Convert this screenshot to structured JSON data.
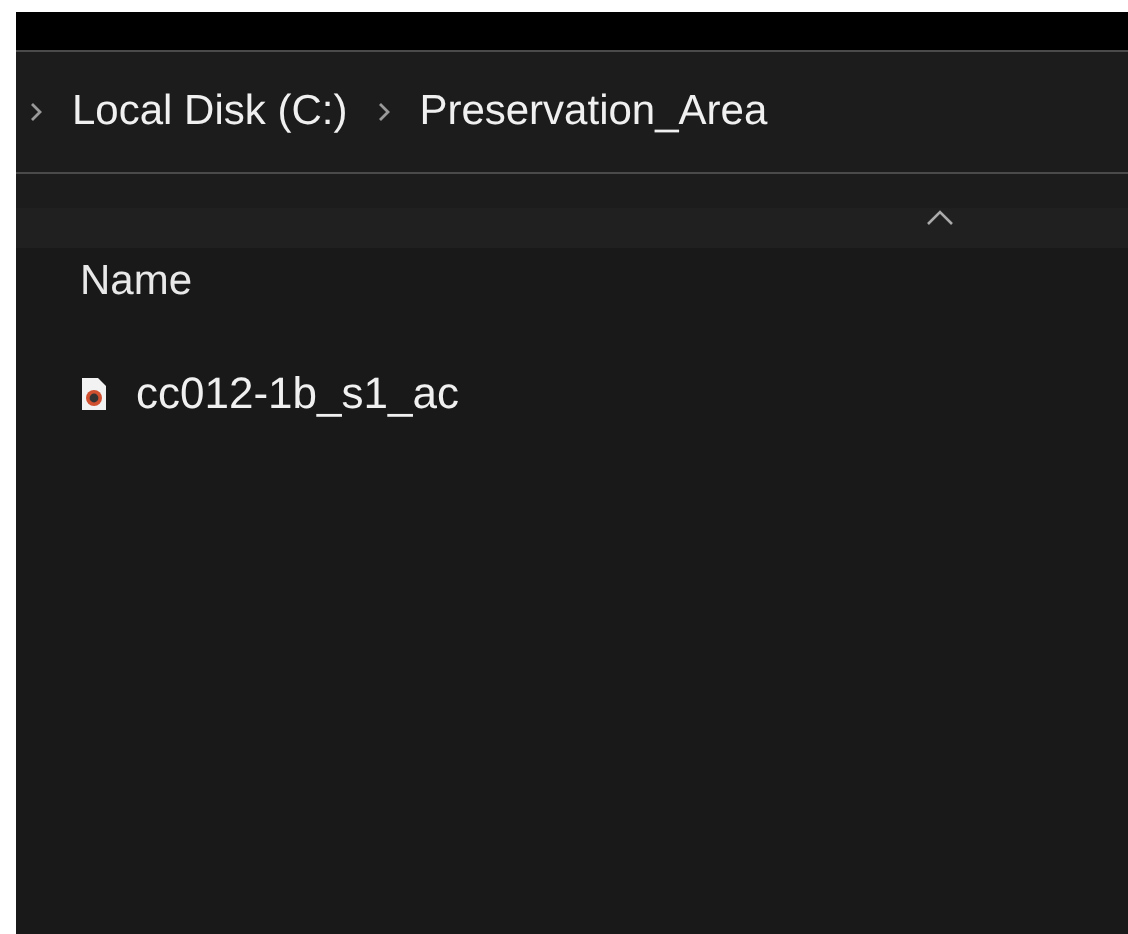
{
  "breadcrumb": [
    "Local Disk (C:)",
    "Preservation_Area"
  ],
  "columns": [
    {
      "label": "Name",
      "sorted": true
    }
  ],
  "files": [
    {
      "name": "cc012-1b_s1_ac",
      "selected": false
    }
  ]
}
